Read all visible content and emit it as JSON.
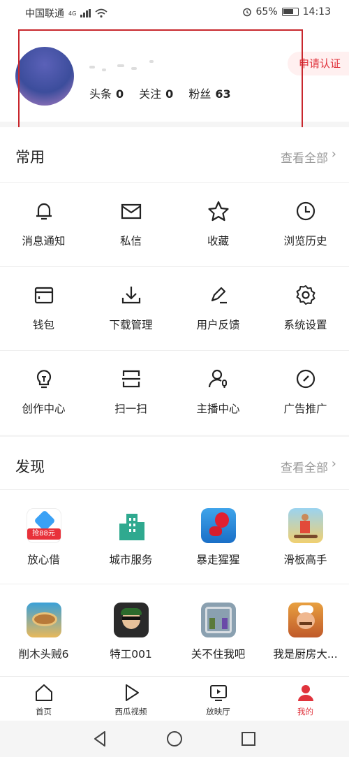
{
  "status_bar": {
    "carrier": "中国联通",
    "network": "4G",
    "battery": "65%",
    "time": "14:13"
  },
  "profile": {
    "stats": [
      {
        "label": "头条",
        "value": "0"
      },
      {
        "label": "关注",
        "value": "0"
      },
      {
        "label": "粉丝",
        "value": "63"
      }
    ],
    "certify_label": "申请认证"
  },
  "common": {
    "title": "常用",
    "view_all": "查看全部",
    "rows": [
      [
        {
          "label": "消息通知",
          "icon": "bell-icon"
        },
        {
          "label": "私信",
          "icon": "mail-icon"
        },
        {
          "label": "收藏",
          "icon": "star-icon"
        },
        {
          "label": "浏览历史",
          "icon": "clock-icon"
        }
      ],
      [
        {
          "label": "钱包",
          "icon": "wallet-icon"
        },
        {
          "label": "下载管理",
          "icon": "download-icon"
        },
        {
          "label": "用户反馈",
          "icon": "pen-icon"
        },
        {
          "label": "系统设置",
          "icon": "gear-icon"
        }
      ],
      [
        {
          "label": "创作中心",
          "icon": "bulb-icon"
        },
        {
          "label": "扫一扫",
          "icon": "scan-icon"
        },
        {
          "label": "主播中心",
          "icon": "anchor-user-icon"
        },
        {
          "label": "广告推广",
          "icon": "gauge-icon"
        }
      ]
    ]
  },
  "discover": {
    "title": "发现",
    "view_all": "查看全部",
    "rows": [
      [
        {
          "label": "放心借",
          "icon": "loan-app-icon",
          "badge": "抢88元"
        },
        {
          "label": "城市服务",
          "icon": "city-app-icon"
        },
        {
          "label": "暴走猩猩",
          "icon": "gorilla-game-icon"
        },
        {
          "label": "滑板高手",
          "icon": "skate-game-icon"
        }
      ],
      [
        {
          "label": "削木头贼6",
          "icon": "wood-game-icon"
        },
        {
          "label": "特工001",
          "icon": "agent-game-icon"
        },
        {
          "label": "关不住我吧",
          "icon": "escape-game-icon"
        },
        {
          "label": "我是厨房大...",
          "icon": "chef-game-icon"
        }
      ]
    ]
  },
  "tabbar": [
    {
      "label": "首页",
      "icon": "home-icon",
      "active": false
    },
    {
      "label": "西瓜视频",
      "icon": "play-icon",
      "active": false
    },
    {
      "label": "放映厅",
      "icon": "screen-icon",
      "active": false
    },
    {
      "label": "我的",
      "icon": "user-icon",
      "active": true
    }
  ],
  "colors": {
    "accent": "#e0333c",
    "highlight_box": "#c8272d"
  }
}
